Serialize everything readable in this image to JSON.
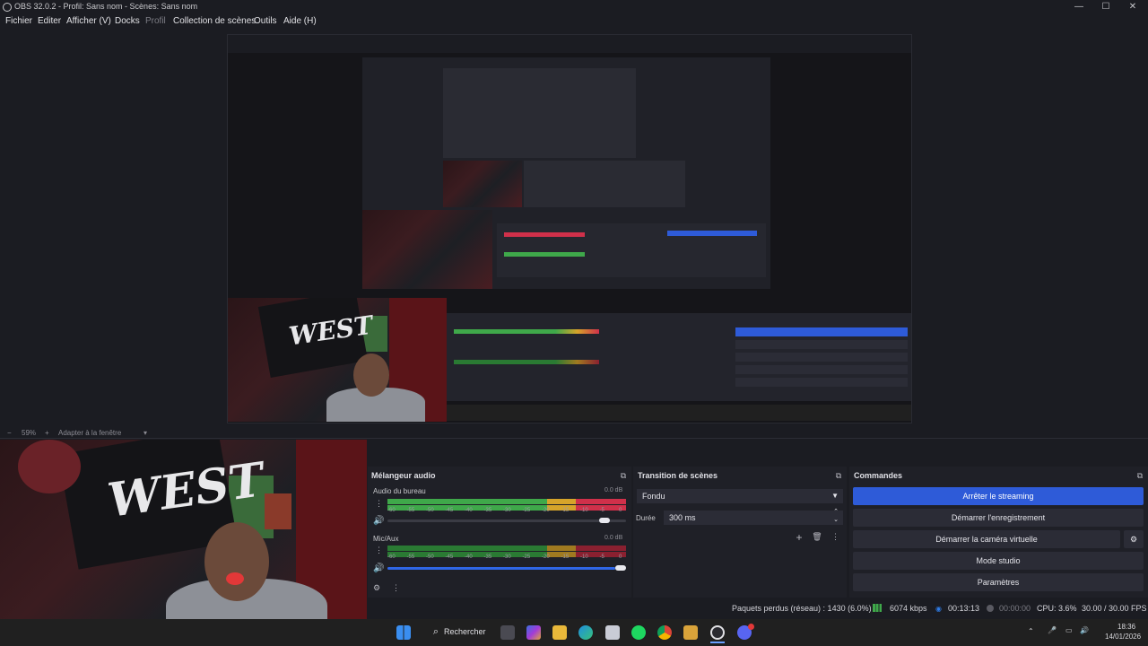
{
  "window": {
    "title": "OBS 32.0.2 - Profil: Sans nom - Scènes: Sans nom"
  },
  "menu": {
    "items": [
      "Fichier",
      "Editer",
      "Afficher (V)",
      "Docks",
      "Profil",
      "Collection de scènes",
      "Outils",
      "Aide (H)"
    ]
  },
  "zoom": {
    "percent": "59%",
    "minus": "−",
    "plus": "+",
    "fit_label": "Adapter à la fenêtre"
  },
  "webcam": {
    "shirt_text": "WEST"
  },
  "mixer": {
    "title": "Mélangeur audio",
    "channels": [
      {
        "name": "Audio du bureau",
        "db": "0.0 dB",
        "volume": 0.93
      },
      {
        "name": "Mic/Aux",
        "db": "0.0 dB",
        "volume": 1.0
      }
    ],
    "ticks": [
      "-60",
      "-55",
      "-50",
      "-45",
      "-40",
      "-35",
      "-30",
      "-25",
      "-20",
      "-15",
      "-10",
      "-5",
      "0"
    ]
  },
  "transitions": {
    "title": "Transition de scènes",
    "selected": "Fondu",
    "duration_label": "Durée",
    "duration_value": "300 ms"
  },
  "controls": {
    "title": "Commandes",
    "buttons": [
      "Arrêter le streaming",
      "Démarrer l'enregistrement",
      "Démarrer la caméra virtuelle",
      "Mode studio",
      "Paramètres"
    ]
  },
  "status": {
    "dropped": "Paquets perdus (réseau) : 1430 (6.0%)",
    "bitrate": "6074 kbps",
    "stream_time": "00:13:13",
    "rec_time": "00:00:00",
    "cpu": "CPU: 3.6%",
    "fps": "30.00 / 30.00 FPS"
  },
  "taskbar": {
    "search": "Rechercher",
    "time": "18:36",
    "date": "14/01/2026"
  },
  "colors": {
    "accent": "#2e5bd8",
    "meter_green": "#3fa84a",
    "meter_yellow": "#d6a42a",
    "meter_red": "#d0304a"
  }
}
